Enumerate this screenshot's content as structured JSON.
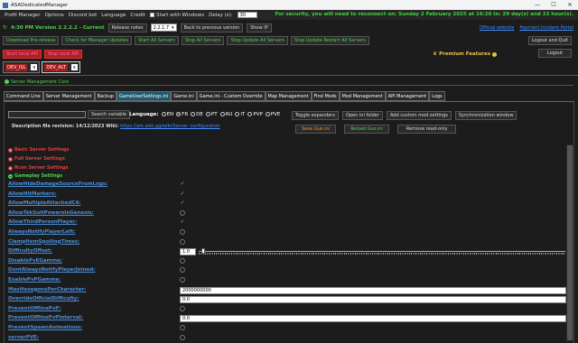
{
  "window": {
    "title": "ASADedicatedManager",
    "min": "—",
    "max": "☐",
    "close": "✕"
  },
  "menu": {
    "items": [
      "Profil Manager",
      "Options",
      "Discord bot",
      "Language",
      "Credit"
    ],
    "start_with_windows": "Start with Windows",
    "delay_label": "Delay (s):",
    "delay_value": "30"
  },
  "security_message": "For security, you will need to reconnect on: Sunday 2 February 2025 at 16:20 In: 29 day(s) and 23 hour(s).",
  "version_row": {
    "time_version": "4:30 PM Version 2.2.2.2 - Current",
    "release_notes": "Release notes",
    "version_select": "2.2.1.7",
    "back_previous": "Back to previous version",
    "show_ip": "Show IP"
  },
  "links": {
    "official": "Official website",
    "payment": "Payment Incident Portal"
  },
  "actions": [
    "Download Pre-release",
    "Check for Manager Updates",
    "Start All Servers",
    "Stop All Servers",
    "Stop Update All Servers",
    "Stop Update Restart All Servers"
  ],
  "red_buttons": [
    "Start local API",
    "Stop local API"
  ],
  "logout_quit": "Logout and Quit",
  "logout": "Logout",
  "premium": "Premium Features",
  "server_tabs": [
    {
      "label": "DEV_ISL",
      "close": "x"
    },
    {
      "label": "DEV_ALT",
      "close": "x"
    }
  ],
  "server_core": "Server Management Core",
  "main_tabs": [
    "Command Line",
    "Server Management",
    "Backup",
    "GameUserSettings.ini",
    "Game.ini",
    "Game.ini - Custom Override",
    "Map Management",
    "Find Mods",
    "Mod Management",
    "API Management",
    "Logs"
  ],
  "active_tab": 3,
  "search_button": "Search variable",
  "language_label": "Language:",
  "languages": [
    "EN",
    "FR",
    "DE",
    "PT",
    "RU",
    "IT",
    "PVP",
    "PVE"
  ],
  "selected_language": "FR",
  "tools1": [
    "Toggle expanders",
    "Open ini folder",
    "Add custom mod settings",
    "Synchronization window"
  ],
  "tools2": [
    "Save Gus.ini",
    "Reload Gus.ini",
    "Remove read-only"
  ],
  "description": {
    "label": "Description file revision: 14/12/2023 Wiki:",
    "url": "https://ark.wiki.gg/wiki/Server_configuration"
  },
  "sections": [
    {
      "label": "Basic Server Settings",
      "color": "#e04040"
    },
    {
      "label": "Full Server Settings",
      "color": "#e04040"
    },
    {
      "label": "Rcon Server Settings",
      "color": "#e04040"
    },
    {
      "label": "Gameplay Settings",
      "color": "#4fd54f"
    }
  ],
  "settings": [
    {
      "name": "AllowHideDamageSourceFromLogs:",
      "type": "check",
      "checked": true
    },
    {
      "name": "AllowHitMarkers:",
      "type": "check",
      "checked": true
    },
    {
      "name": "AllowMultipleAttachedC4:",
      "type": "check",
      "checked": true
    },
    {
      "name": "AllowTekSuitPowersInGenesis:",
      "type": "check",
      "checked": false
    },
    {
      "name": "AllowThirdPersonPlayer:",
      "type": "check",
      "checked": true
    },
    {
      "name": "AlwaysNotifyPlayerLeft:",
      "type": "check",
      "checked": false
    },
    {
      "name": "ClampItemSpoilingTimes:",
      "type": "check",
      "checked": false
    },
    {
      "name": "DifficultyOffset:",
      "type": "slider",
      "value": "1.0",
      "level": 0.0
    },
    {
      "name": "DisablePvEGamma:",
      "type": "check",
      "checked": false
    },
    {
      "name": "DontAlwaysNotifyPlayerJoined:",
      "type": "check",
      "checked": false
    },
    {
      "name": "EnablePvPGamma:",
      "type": "check",
      "checked": false
    },
    {
      "name": "MaxHexagonsPerCharacter:",
      "type": "text",
      "value": "2000000000"
    },
    {
      "name": "OverrideOfficialDifficulty:",
      "type": "text",
      "value": "0.0"
    },
    {
      "name": "PreventOfflinePvP:",
      "type": "check",
      "checked": false
    },
    {
      "name": "PreventOfflinePvPInterval:",
      "type": "text",
      "value": "0.0"
    },
    {
      "name": "PreventSpawnAnimations:",
      "type": "check",
      "checked": false
    },
    {
      "name": "serverPVE:",
      "type": "check",
      "checked": false
    }
  ]
}
